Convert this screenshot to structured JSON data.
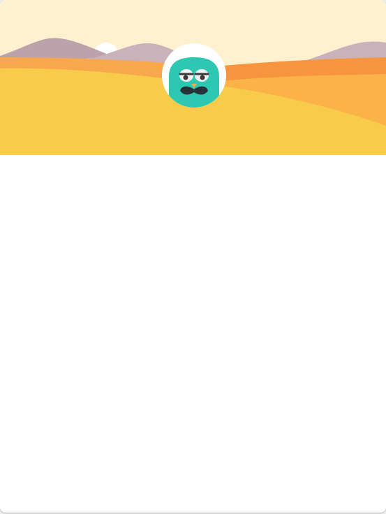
{
  "colors": {
    "sky": "#fdf1cf",
    "sun": "#ffffff",
    "mountain_back": "#c9b2ba",
    "mountain_front": "#bda2ab",
    "dune_orange": "#f9a74d",
    "dune_dark_orange": "#f7953f",
    "dune_light_orange": "#fbb249",
    "dune_yellow": "#f8cb4a",
    "avatar_bg": "#ffffff",
    "mascot_body": "#2dc8b1",
    "mascot_eye_white": "#f1f1f1",
    "mascot_pupil": "#3a3a3a",
    "mascot_beak": "#f9a74d",
    "mascot_mustache": "#263238"
  },
  "icons": {
    "banner": "desert-landscape-illustration",
    "avatar": "mustache-bird-mascot-icon"
  }
}
